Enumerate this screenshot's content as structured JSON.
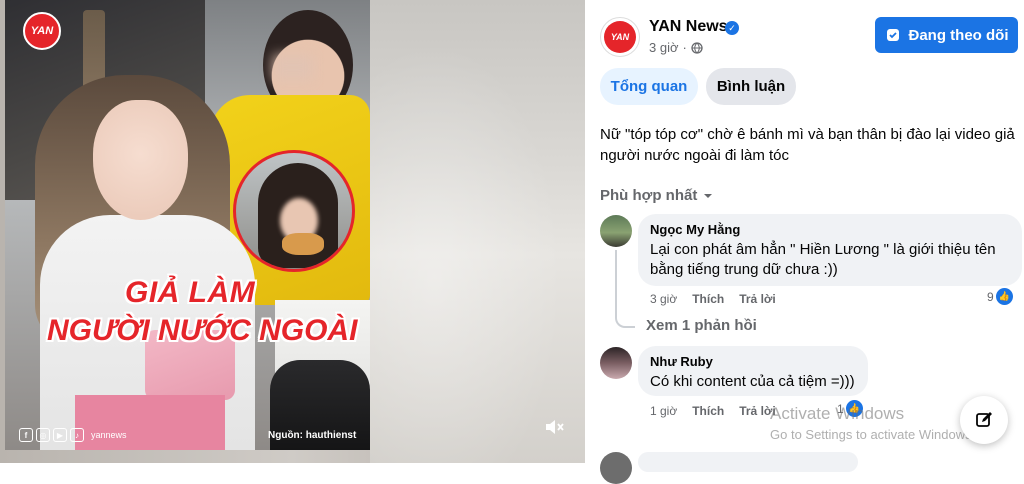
{
  "video": {
    "logo_text": "YAN",
    "headline_line1": "GIẢ LÀM",
    "headline_line2": "NGƯỜI NƯỚC NGOÀI",
    "social_handle": "yannews",
    "source_label": "Nguồn: hauthienst"
  },
  "post": {
    "page_name": "YAN News",
    "avatar_text": "YAN",
    "time": "3 giờ",
    "follow_label": "Đang theo dõi",
    "caption": "Nữ \"tóp tóp cơ\" chờ ê bánh mì và bạn thân bị đào lại video giả người nước ngoài đi làm tóc"
  },
  "tabs": [
    {
      "label": "Tổng quan"
    },
    {
      "label": "Bình luận"
    }
  ],
  "sort_label": "Phù hợp nhất",
  "comments": [
    {
      "author": "Ngọc My Hằng",
      "text": "Lại con phát âm hẳn \" Hiền Lương \" là giới thiệu tên bằng tiếng trung dữ chưa :))",
      "time": "3 giờ",
      "like_label": "Thích",
      "reply_label": "Trả lời",
      "reaction_count": "9"
    },
    {
      "author": "Như Ruby",
      "text": "Có khi content của cả tiệm =)))",
      "time": "1 giờ",
      "like_label": "Thích",
      "reply_label": "Trả lời",
      "reaction_count": "1"
    }
  ],
  "see_replies": "Xem 1 phản hồi",
  "watermark": {
    "line1": "Activate Windows",
    "line2": "Go to Settings to activate Windows."
  },
  "colors": {
    "accent": "#1b74e4",
    "brand_red": "#e5252a",
    "bubble": "#f0f2f5",
    "muted": "#65676b"
  },
  "icons": [
    "globe-icon",
    "verified-icon",
    "follow-check-icon",
    "chevron-down-icon",
    "like-icon",
    "mute-icon",
    "compose-icon"
  ]
}
